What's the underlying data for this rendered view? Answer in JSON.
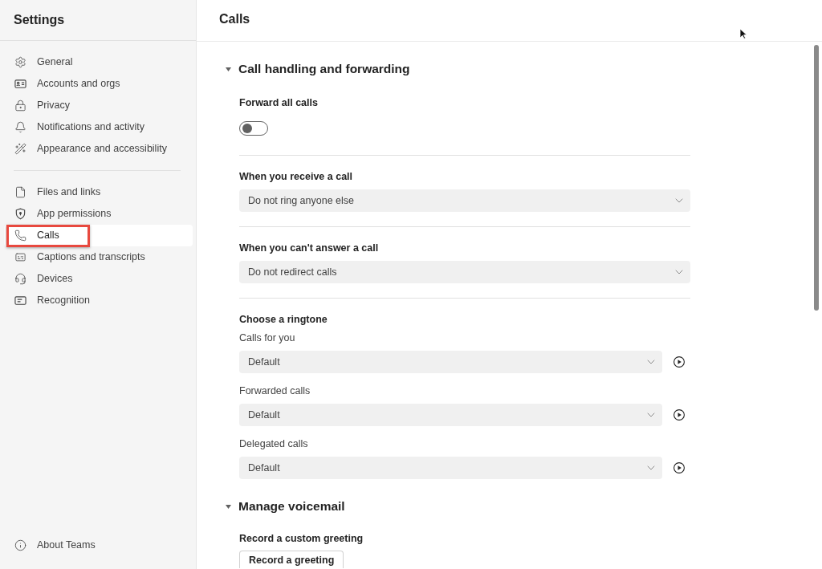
{
  "sidebar": {
    "title": "Settings",
    "groups": [
      {
        "items": [
          {
            "label": "General",
            "selected": false,
            "highlighted": false
          },
          {
            "label": "Accounts and orgs",
            "selected": false,
            "highlighted": false
          },
          {
            "label": "Privacy",
            "selected": false,
            "highlighted": false
          },
          {
            "label": "Notifications and activity",
            "selected": false,
            "highlighted": false
          },
          {
            "label": "Appearance and accessibility",
            "selected": false,
            "highlighted": false
          }
        ]
      },
      {
        "items": [
          {
            "label": "Files and links",
            "selected": false,
            "highlighted": false
          },
          {
            "label": "App permissions",
            "selected": false,
            "highlighted": false
          },
          {
            "label": "Calls",
            "selected": true,
            "highlighted": true
          },
          {
            "label": "Captions and transcripts",
            "selected": false,
            "highlighted": false
          },
          {
            "label": "Devices",
            "selected": false,
            "highlighted": false
          },
          {
            "label": "Recognition",
            "selected": false,
            "highlighted": false
          }
        ]
      }
    ],
    "footer": [
      {
        "label": "About Teams",
        "selected": false,
        "highlighted": false
      }
    ]
  },
  "main": {
    "title": "Calls",
    "sections": [
      {
        "title": "Call handling and forwarding",
        "expanded": true,
        "blocks": [
          {
            "kind": "toggle",
            "label": "Forward all calls",
            "on": false
          },
          {
            "kind": "select",
            "label": "When you receive a call",
            "value": "Do not ring anyone else"
          },
          {
            "kind": "select",
            "label": "When you can't answer a call",
            "value": "Do not redirect calls"
          },
          {
            "kind": "ringtones",
            "label": "Choose a ringtone",
            "rows": [
              {
                "label": "Calls for you",
                "value": "Default"
              },
              {
                "label": "Forwarded calls",
                "value": "Default"
              },
              {
                "label": "Delegated calls",
                "value": "Default"
              }
            ]
          }
        ]
      },
      {
        "title": "Manage voicemail",
        "expanded": true,
        "blocks": [
          {
            "kind": "button",
            "label": "Record a custom greeting",
            "button": "Record a greeting"
          }
        ]
      }
    ]
  }
}
